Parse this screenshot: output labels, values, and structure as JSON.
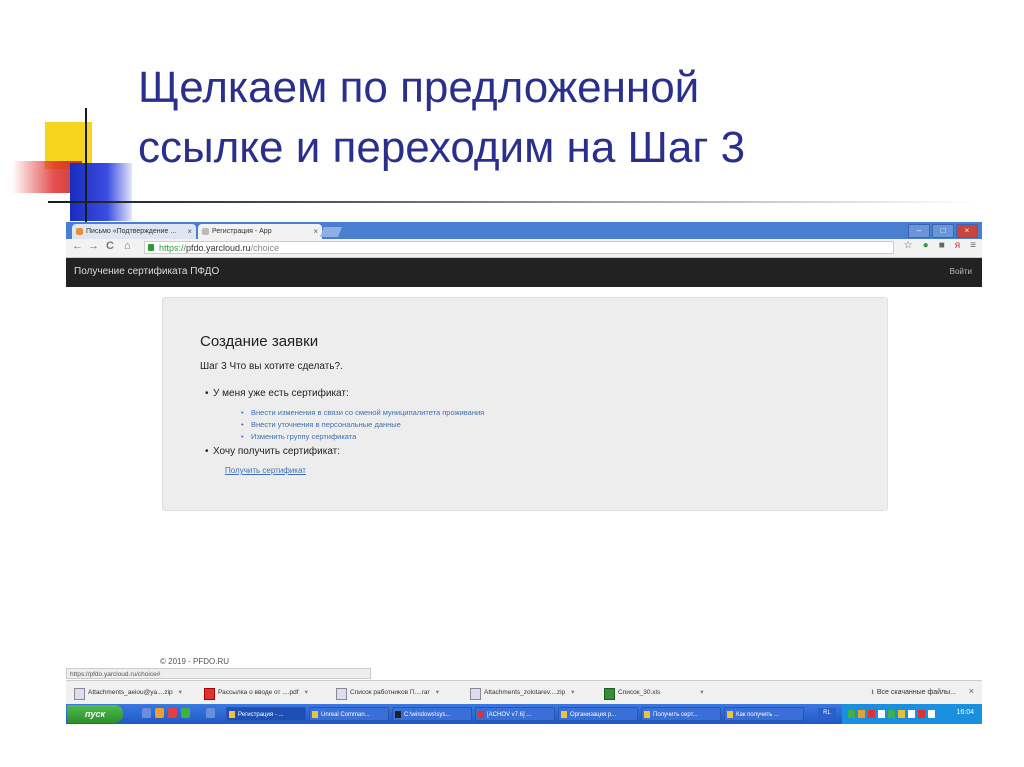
{
  "slide": {
    "title_line1": "Щелкаем по предложенной",
    "title_line2": "ссылке и переходим на Шаг 3"
  },
  "browser": {
    "tabs": [
      {
        "label": "Письмо «Подтверждение ...",
        "close": "×"
      },
      {
        "label": "Регистрация - App",
        "close": "×"
      }
    ],
    "window_buttons": [
      "–",
      "□",
      "×"
    ],
    "url": {
      "scheme": "https://",
      "host": "pfdo.yarcloud.ru",
      "path": "/choice"
    },
    "app": {
      "brand": "Получение сертификата ПФДО",
      "login": "Войти"
    },
    "panel": {
      "heading": "Создание заявки",
      "step": "Шаг 3 Что вы хотите сделать?.",
      "option_have": "У меня уже есть сертификат:",
      "links": [
        "Внести изменения в связи со сменой муниципалитета проживания",
        "Внести уточнения в персональные данные",
        "Изменить группу сертификата"
      ],
      "option_want": "Хочу получить сертификат:",
      "get_cert": "Получить сертификат"
    },
    "footer": "© 2019 - PFDO.RU",
    "status_url": "https://pfdo.yarcloud.ru/choice#",
    "downloads": [
      {
        "name": "Attachments_aeiou@ya....zip",
        "icon": "zip-icon"
      },
      {
        "name": "Рассылка о вводе от ....pdf",
        "icon": "pdf-icon"
      },
      {
        "name": "Список работников П....rar",
        "icon": "rar-icon"
      },
      {
        "name": "Attachments_zolotarev....zip",
        "icon": "zip-icon"
      },
      {
        "name": "Список_30.xls",
        "icon": "xls-icon"
      }
    ],
    "downloads_all": "Все скачанные файлы...",
    "taskbar": {
      "start": "пуск",
      "tasks": [
        "Регистрация - ...",
        "Unreal Comman...",
        "C:\\windows\\sys...",
        "[ACHOV v7.6] ...",
        "Организация р...",
        "Получить серт...",
        "Как получить ..."
      ],
      "lang": "RL",
      "clock": "16:04"
    }
  }
}
